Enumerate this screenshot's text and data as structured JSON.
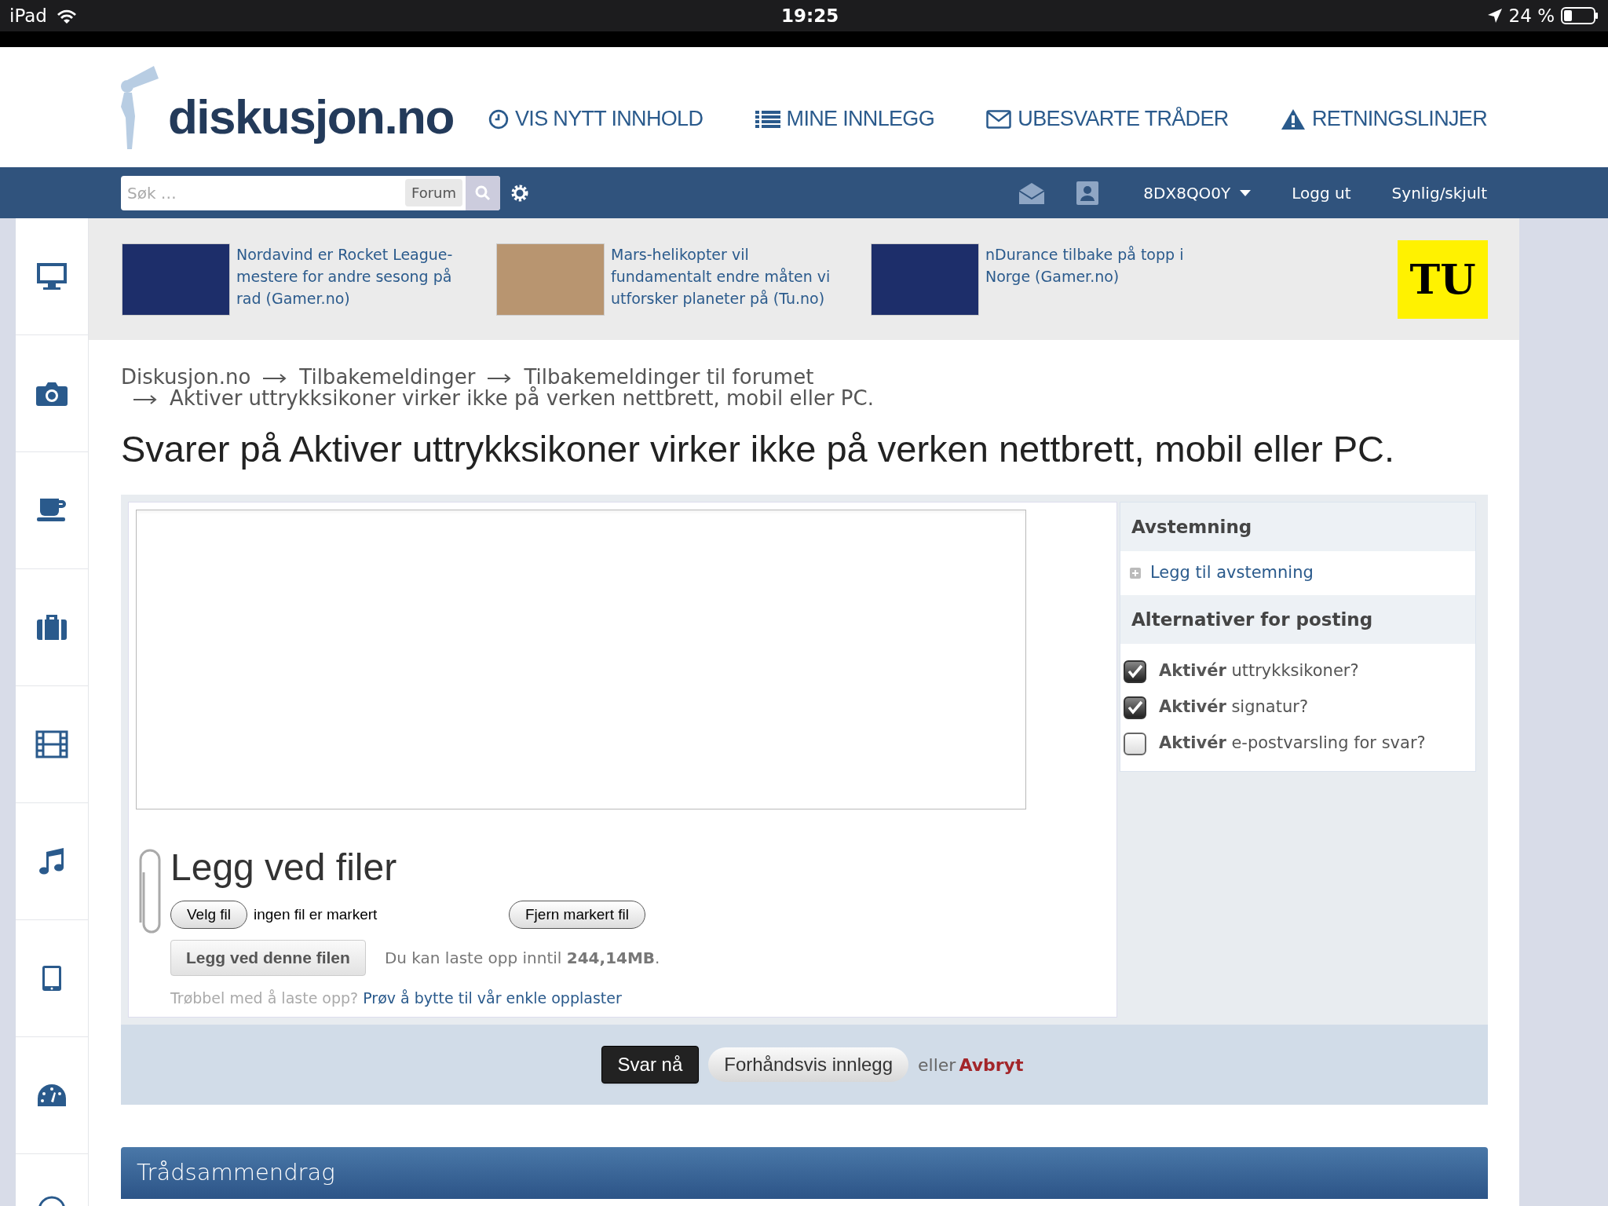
{
  "status_bar": {
    "device": "iPad",
    "time": "19:25",
    "battery": "24 %"
  },
  "header": {
    "logo": "diskusjon.no",
    "nav": [
      {
        "kind": "clock",
        "label": "VIS NYTT INNHOLD"
      },
      {
        "kind": "list",
        "label": "MINE INNLEGG"
      },
      {
        "kind": "mail",
        "label": "UBESVARTE TRÅDER"
      },
      {
        "kind": "warning",
        "label": "RETNINGSLINJER"
      }
    ]
  },
  "user_bar": {
    "search": {
      "placeholder": "Søk …",
      "scope": "Forum"
    },
    "username": "8DX8QO0Y",
    "links": [
      "Logg ut",
      "Synlig/skjult"
    ]
  },
  "sidebar": {
    "items": [
      {
        "kind": "monitor"
      },
      {
        "kind": "camera"
      },
      {
        "kind": "cup"
      },
      {
        "kind": "briefcase"
      },
      {
        "kind": "film"
      },
      {
        "kind": "music"
      },
      {
        "kind": "tablet"
      },
      {
        "kind": "gauge"
      },
      {
        "kind": "circle"
      }
    ]
  },
  "news": [
    {
      "title": "Nordavind er Rocket League-mestere for andre sesong på rad (Gamer.no)",
      "kind": "team"
    },
    {
      "title": "Mars-helikopter vil fundamentalt endre måten vi utforsker planeter på (Tu.no)",
      "kind": "mars"
    },
    {
      "title": "nDurance tilbake på topp i Norge (Gamer.no)",
      "kind": "team"
    }
  ],
  "ad_logo": "TU",
  "breadcrumb": [
    "Diskusjon.no",
    "Tilbakemeldinger",
    "Tilbakemeldinger til forumet",
    "Aktiver uttrykksikoner virker ikke på verken nettbrett, mobil eller PC."
  ],
  "page_title": "Svarer på Aktiver uttrykksikoner virker ikke på verken nettbrett, mobil eller PC.",
  "attachments": {
    "title": "Legg ved filer",
    "choose_button": "Velg fil",
    "no_file": "ingen fil er markert",
    "remove_button": "Fjern markert fil",
    "attach_button": "Legg ved denne filen",
    "limit": "Du kan laste opp inntil **244,14MB**.",
    "trouble": "Trøbbel med å laste opp?",
    "trouble_link": "Prøv å bytte til vår enkle opplaster"
  },
  "side_panel": {
    "poll_heading": "Avstemning",
    "poll_link": "Legg til avstemning",
    "options_heading": "Alternativer for posting",
    "options": [
      {
        "label": "**Aktivér** uttrykksikoner?",
        "checked": true
      },
      {
        "label": "**Aktivér** signatur?",
        "checked": true
      },
      {
        "label": "**Aktivér** e-postvarsling for svar?",
        "checked": false
      }
    ]
  },
  "actions": {
    "submit": "Svar nå",
    "preview": "Forhåndsvis innlegg",
    "or": "eller",
    "cancel": "Avbryt"
  },
  "summary_heading": "Trådsammendrag"
}
